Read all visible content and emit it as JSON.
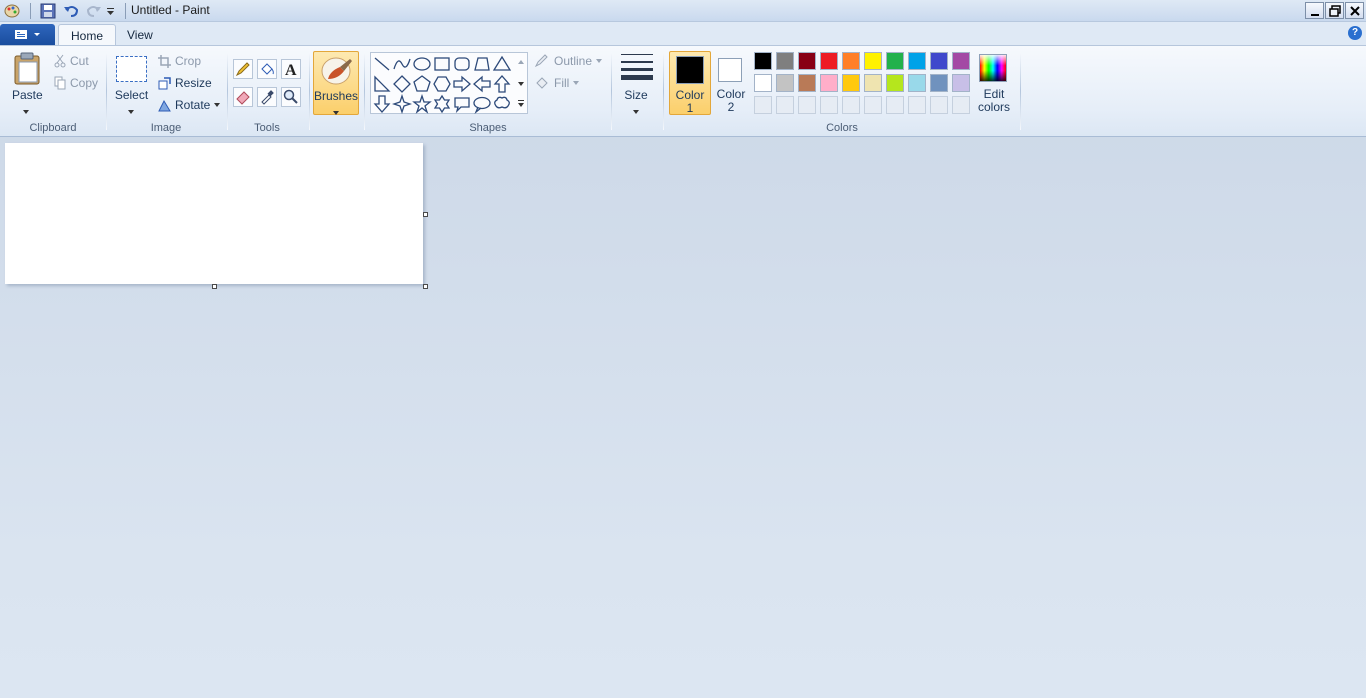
{
  "titlebar": {
    "title": "Untitled - Paint",
    "icons": [
      "paint-app-icon",
      "save-icon",
      "undo-icon",
      "redo-icon",
      "customize-qat-icon"
    ],
    "window_buttons": [
      "minimize",
      "restore",
      "close"
    ]
  },
  "tabs": {
    "file_menu": "file-menu",
    "home": "Home",
    "view": "View"
  },
  "clipboard": {
    "paste": "Paste",
    "cut": "Cut",
    "copy": "Copy",
    "label": "Clipboard"
  },
  "image": {
    "select": "Select",
    "crop": "Crop",
    "resize": "Resize",
    "rotate": "Rotate",
    "label": "Image"
  },
  "tools": {
    "label": "Tools"
  },
  "brushes": {
    "label": "Brushes"
  },
  "shapes": {
    "outline": "Outline",
    "fill": "Fill",
    "label": "Shapes"
  },
  "size": {
    "label": "Size"
  },
  "colors": {
    "color1_line1": "Color",
    "color1_line2": "1",
    "color2_line1": "Color",
    "color2_line2": "2",
    "edit_line1": "Edit",
    "edit_line2": "colors",
    "label": "Colors",
    "color1_value": "#000000",
    "color2_value": "#ffffff",
    "palette_row1": [
      "#000000",
      "#7f7f7f",
      "#880015",
      "#ed1c24",
      "#ff7f27",
      "#fff200",
      "#22b14c",
      "#00a2e8",
      "#3f48cc",
      "#a349a4"
    ],
    "palette_row2": [
      "#ffffff",
      "#c3c3c3",
      "#b97a57",
      "#ffaec9",
      "#ffc90e",
      "#efe4b0",
      "#b5e61d",
      "#99d9ea",
      "#7092be",
      "#c8bfe7"
    ],
    "palette_row3_empty": 10
  }
}
